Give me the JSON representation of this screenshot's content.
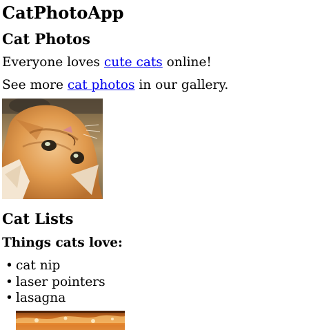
{
  "header": {
    "app_title": "CatPhotoApp"
  },
  "photos_section": {
    "heading": "Cat Photos",
    "line1": {
      "before": "Everyone loves ",
      "link": "cute cats",
      "after": " online!"
    },
    "line2": {
      "before": "See more ",
      "link": "cat photos",
      "after": " in our gallery."
    }
  },
  "lists_section": {
    "heading": "Cat Lists",
    "subheading": "Things cats love:",
    "items": [
      {
        "bullet": "•",
        "label": "cat nip"
      },
      {
        "bullet": "•",
        "label": "laser pointers"
      },
      {
        "bullet": "•",
        "label": "lasagna"
      }
    ]
  },
  "colors": {
    "link": "#0000ee",
    "text": "#000000",
    "background": "#ffffff"
  }
}
